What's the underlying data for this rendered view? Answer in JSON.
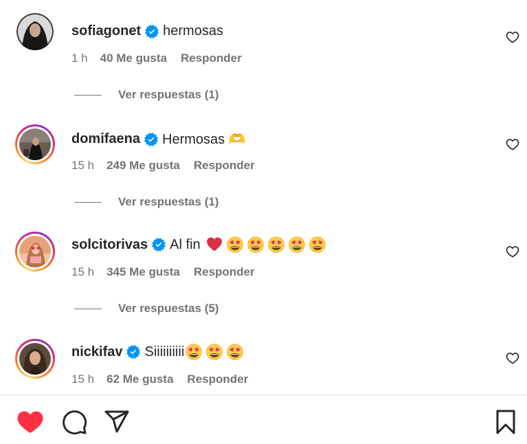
{
  "comments": [
    {
      "username": "sofiagonet",
      "text": "hermosas",
      "emojis": [],
      "time": "1 h",
      "likes": "40 Me gusta",
      "reply": "Responder",
      "view_replies": "Ver respuestas (1)"
    },
    {
      "username": "domifaena",
      "text": "Hermosas 🫶",
      "emojis": [],
      "time": "15 h",
      "likes": "249 Me gusta",
      "reply": "Responder",
      "view_replies": "Ver respuestas (1)"
    },
    {
      "username": "solcitorivas",
      "text": "Al fin",
      "emojis": [
        "red-heart",
        "heart-eyes",
        "heart-eyes",
        "heart-eyes",
        "heart-eyes",
        "heart-eyes"
      ],
      "time": "15 h",
      "likes": "345 Me gusta",
      "reply": "Responder",
      "view_replies": "Ver respuestas (5)"
    },
    {
      "username": "nickifav",
      "text": "Siiiiiiiiii",
      "emojis": [
        "heart-eyes",
        "heart-eyes",
        "heart-eyes"
      ],
      "time": "15 h",
      "likes": "62 Me gusta",
      "reply": "Responder",
      "view_replies": ""
    }
  ],
  "actions": {
    "like_icon": "heart-filled-icon",
    "comment_icon": "comment-icon",
    "share_icon": "share-icon",
    "save_icon": "bookmark-icon"
  },
  "colors": {
    "verified": "#0095f6",
    "liked_heart": "#ff3040",
    "meta_text": "#737373",
    "text": "#262626"
  }
}
